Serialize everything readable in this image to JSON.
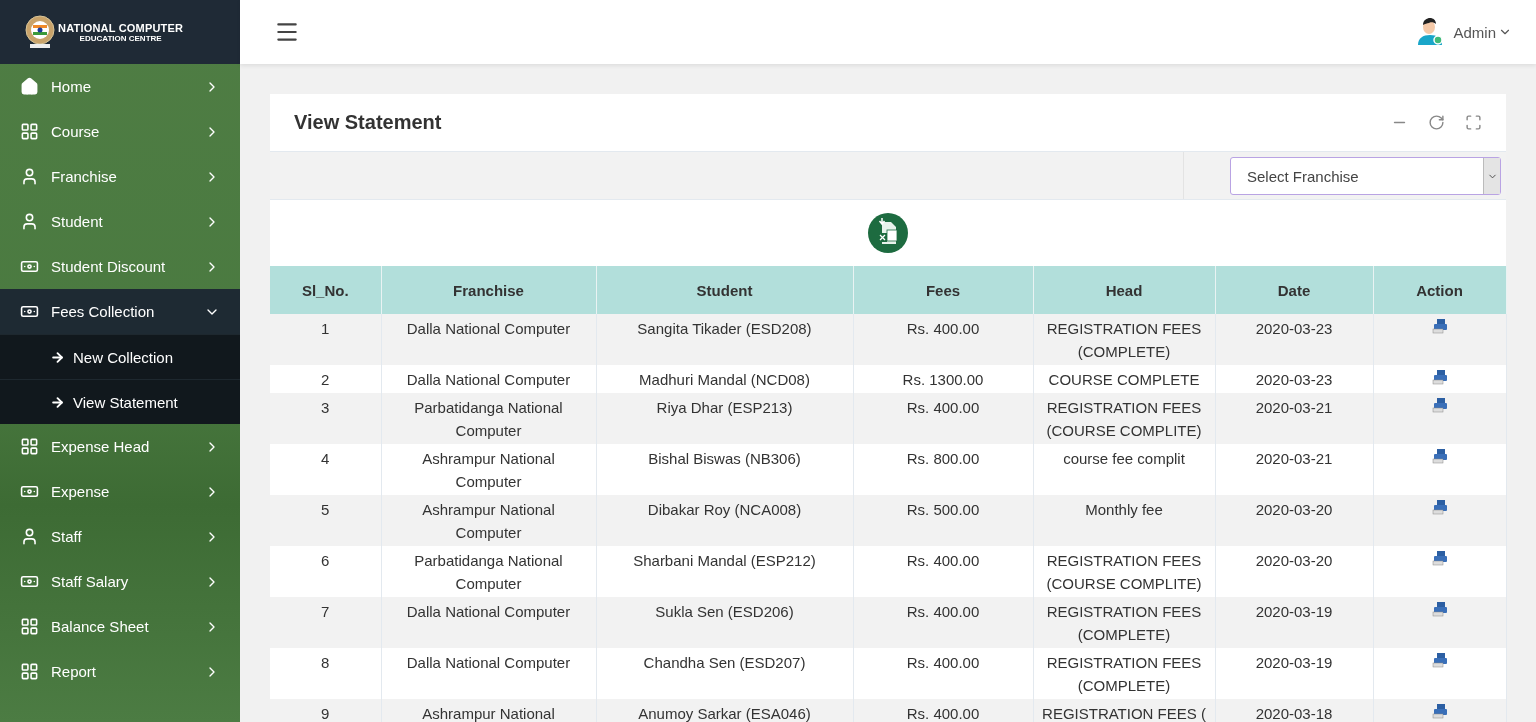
{
  "brand": {
    "line1": "NATIONAL COMPUTER",
    "line2": "EDUCATION CENTRE"
  },
  "sidebar": {
    "items": [
      {
        "label": "Home",
        "expanded": false
      },
      {
        "label": "Course",
        "expanded": false
      },
      {
        "label": "Franchise",
        "expanded": false
      },
      {
        "label": "Student",
        "expanded": false
      },
      {
        "label": "Student Discount",
        "expanded": false
      },
      {
        "label": "Fees Collection",
        "expanded": true,
        "children": [
          {
            "label": "New Collection"
          },
          {
            "label": "View Statement"
          }
        ]
      },
      {
        "label": "Expense Head",
        "expanded": false
      },
      {
        "label": "Expense",
        "expanded": false
      },
      {
        "label": "Staff",
        "expanded": false
      },
      {
        "label": "Staff Salary",
        "expanded": false
      },
      {
        "label": "Balance Sheet",
        "expanded": false
      },
      {
        "label": "Report",
        "expanded": false
      }
    ]
  },
  "header": {
    "user": "Admin"
  },
  "card": {
    "title": "View Statement",
    "select": {
      "placeholder": "Select Franchise"
    },
    "table": {
      "columns": [
        "Sl_No.",
        "Franchise",
        "Student",
        "Fees",
        "Head",
        "Date",
        "Action"
      ],
      "rows": [
        {
          "sl": "1",
          "franchise": "Dalla National Computer",
          "student": "Sangita Tikader (ESD208)",
          "fees": "Rs. 400.00",
          "head": "REGISTRATION FEES (COMPLETE)",
          "date": "2020-03-23"
        },
        {
          "sl": "2",
          "franchise": "Dalla National Computer",
          "student": "Madhuri Mandal (NCD08)",
          "fees": "Rs. 1300.00",
          "head": "COURSE COMPLETE",
          "date": "2020-03-23"
        },
        {
          "sl": "3",
          "franchise": "Parbatidanga National Computer",
          "student": "Riya Dhar (ESP213)",
          "fees": "Rs. 400.00",
          "head": "REGISTRATION FEES (COURSE COMPLITE)",
          "date": "2020-03-21"
        },
        {
          "sl": "4",
          "franchise": "Ashrampur National Computer",
          "student": "Bishal Biswas (NB306)",
          "fees": "Rs. 800.00",
          "head": "course fee complit",
          "date": "2020-03-21"
        },
        {
          "sl": "5",
          "franchise": "Ashrampur National Computer",
          "student": "Dibakar Roy (NCA008)",
          "fees": "Rs. 500.00",
          "head": "Monthly fee",
          "date": "2020-03-20"
        },
        {
          "sl": "6",
          "franchise": "Parbatidanga National Computer",
          "student": "Sharbani Mandal (ESP212)",
          "fees": "Rs. 400.00",
          "head": "REGISTRATION FEES (COURSE COMPLITE)",
          "date": "2020-03-20"
        },
        {
          "sl": "7",
          "franchise": "Dalla National Computer",
          "student": "Sukla Sen (ESD206)",
          "fees": "Rs. 400.00",
          "head": "REGISTRATION FEES (COMPLETE)",
          "date": "2020-03-19"
        },
        {
          "sl": "8",
          "franchise": "Dalla National Computer",
          "student": "Chandha Sen (ESD207)",
          "fees": "Rs. 400.00",
          "head": "REGISTRATION FEES (COMPLETE)",
          "date": "2020-03-19"
        },
        {
          "sl": "9",
          "franchise": "Ashrampur National",
          "student": "Anumoy Sarkar (ESA046)",
          "fees": "Rs. 400.00",
          "head": "REGISTRATION FEES (",
          "date": "2020-03-18"
        }
      ]
    }
  }
}
